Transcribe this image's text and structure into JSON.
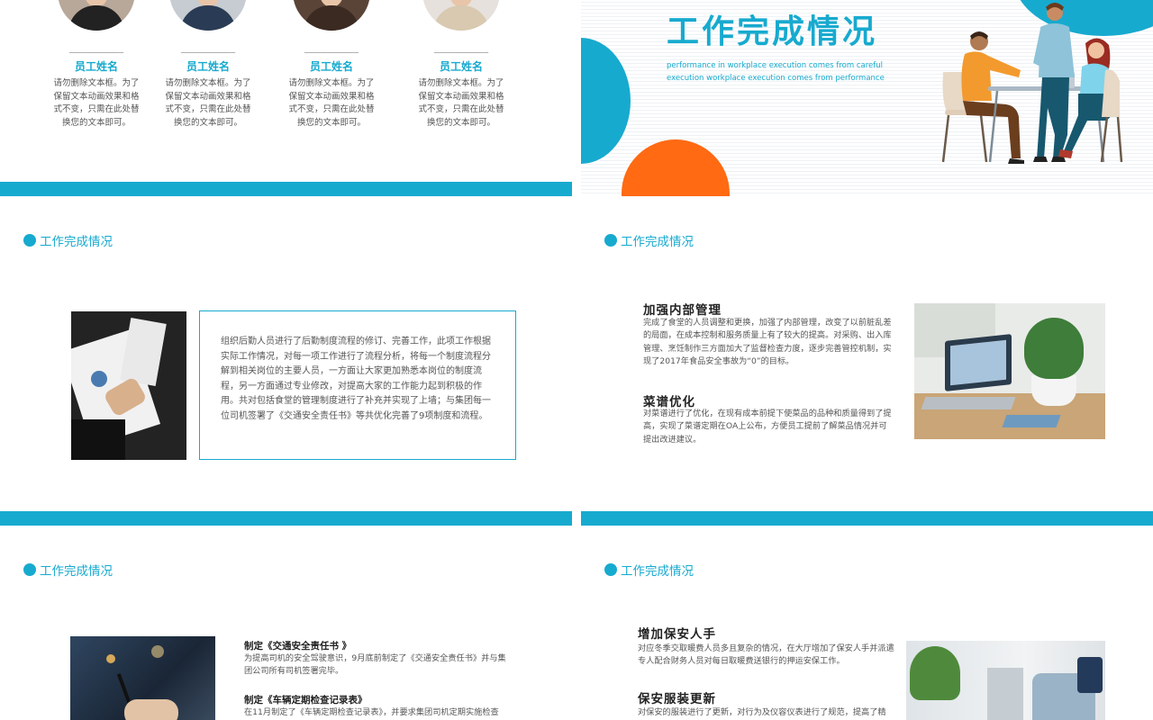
{
  "slide1": {
    "members": [
      {
        "dashes": "__________",
        "name": "员工姓名",
        "desc": "请勿删除文本框。为了保留文本动画效果和格式不变，只需在此处替换您的文本即可。"
      },
      {
        "dashes": "__________",
        "name": "员工姓名",
        "desc": "请勿删除文本框。为了保留文本动画效果和格式不变，只需在此处替换您的文本即可。"
      },
      {
        "dashes": "__________",
        "name": "员工姓名",
        "desc": "请勿删除文本框。为了保留文本动画效果和格式不变，只需在此处替换您的文本即可。"
      },
      {
        "dashes": "__________",
        "name": "员工姓名",
        "desc": "请勿删除文本框。为了保留文本动画效果和格式不变，只需在此处替换您的文本即可。"
      }
    ]
  },
  "slide2": {
    "title": "工作完成情况",
    "sub1": "performance in workplace execution comes from careful",
    "sub2": "execution workplace execution comes from performance"
  },
  "slide3": {
    "section": "工作完成情况",
    "body": "组织后勤人员进行了后勤制度流程的修订、完善工作，此项工作根据实际工作情况，对每一项工作进行了流程分析，将每一个制度流程分解到相关岗位的主要人员，一方面让大家更加熟悉本岗位的制度流程，另一方面通过专业修改，对提高大家的工作能力起到积极的作用。共对包括食堂的管理制度进行了补充并实现了上墙；与集团每一位司机签署了《交通安全责任书》等共优化完善了9项制度和流程。"
  },
  "slide4": {
    "section": "工作完成情况",
    "h1": "加强内部管理",
    "p1": "完成了食堂的人员调整和更换，加强了内部管理，改变了以前脏乱差的局面，在成本控制和服务质量上有了较大的提高。对采购、出入库管理、烹饪制作三方面加大了监督检查力度，逐步完善管控机制，实现了2017年食品安全事故为“0”的目标。",
    "h2": "菜谱优化",
    "p2": "对菜谱进行了优化，在现有成本前提下使菜品的品种和质量得到了提高，实现了菜谱定期在OA上公布，方便员工提前了解菜品情况并可提出改进建议。"
  },
  "slide5": {
    "section": "工作完成情况",
    "h1": "制定《交通安全责任书 》",
    "p1": "为提高司机的安全驾驶意识，9月底前制定了《交通安全责任书》并与集团公司所有司机签署完毕。",
    "h2": "制定《车辆定期检查记录表》",
    "p2": "在11月制定了《车辆定期检查记录表》，并要求集团司机定期实施检查"
  },
  "slide6": {
    "section": "工作完成情况",
    "h1": "增加保安人手",
    "p1": "对应冬季交取暖费人员多且复杂的情况，在大厅增加了保安人手并派遣专人配合财务人员对每日取暖费送银行的押运安保工作。",
    "h2": "保安服装更新",
    "p2": "对保安的服装进行了更新，对行为及仪容仪表进行了规范，提高了精"
  },
  "colors": {
    "accent": "#17aacf",
    "orange": "#ff6a13"
  }
}
